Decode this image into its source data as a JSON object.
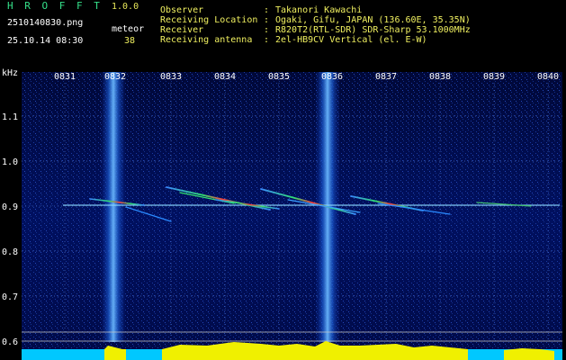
{
  "app": {
    "logo": "H R O F F T",
    "version": "1.0.0"
  },
  "file": {
    "name": "2510140830.png",
    "datetime": "25.10.14 08:30"
  },
  "meteor": {
    "label": "meteor",
    "count": "38"
  },
  "info": [
    {
      "label": "Observer",
      "sep": ":",
      "value": "Takanori Kawachi"
    },
    {
      "label": "Receiving Location",
      "sep": ":",
      "value": "Ogaki, Gifu, JAPAN (136.60E, 35.35N)"
    },
    {
      "label": "Receiver",
      "sep": ":",
      "value": "R820T2(RTL-SDR) SDR-Sharp 53.1000MHz"
    },
    {
      "label": "Receiving antenna",
      "sep": ":",
      "value": "2el-HB9CV Vertical (el. E-W)"
    }
  ],
  "spectrogram": {
    "unit_label": "kHz",
    "time_ticks": [
      "0831",
      "0832",
      "0833",
      "0834",
      "0835",
      "0836",
      "0837",
      "0838",
      "0839",
      "0840"
    ],
    "freq_ticks": [
      "1.1",
      "1.0",
      "0.9",
      "0.8",
      "0.7",
      "0.6"
    ],
    "colors": {
      "grid": "#4a6fc8",
      "text": "#ffffff",
      "bottom_fill": "#f0f000",
      "bottom_edge": "#00c8ff",
      "background": "#000a50"
    }
  }
}
